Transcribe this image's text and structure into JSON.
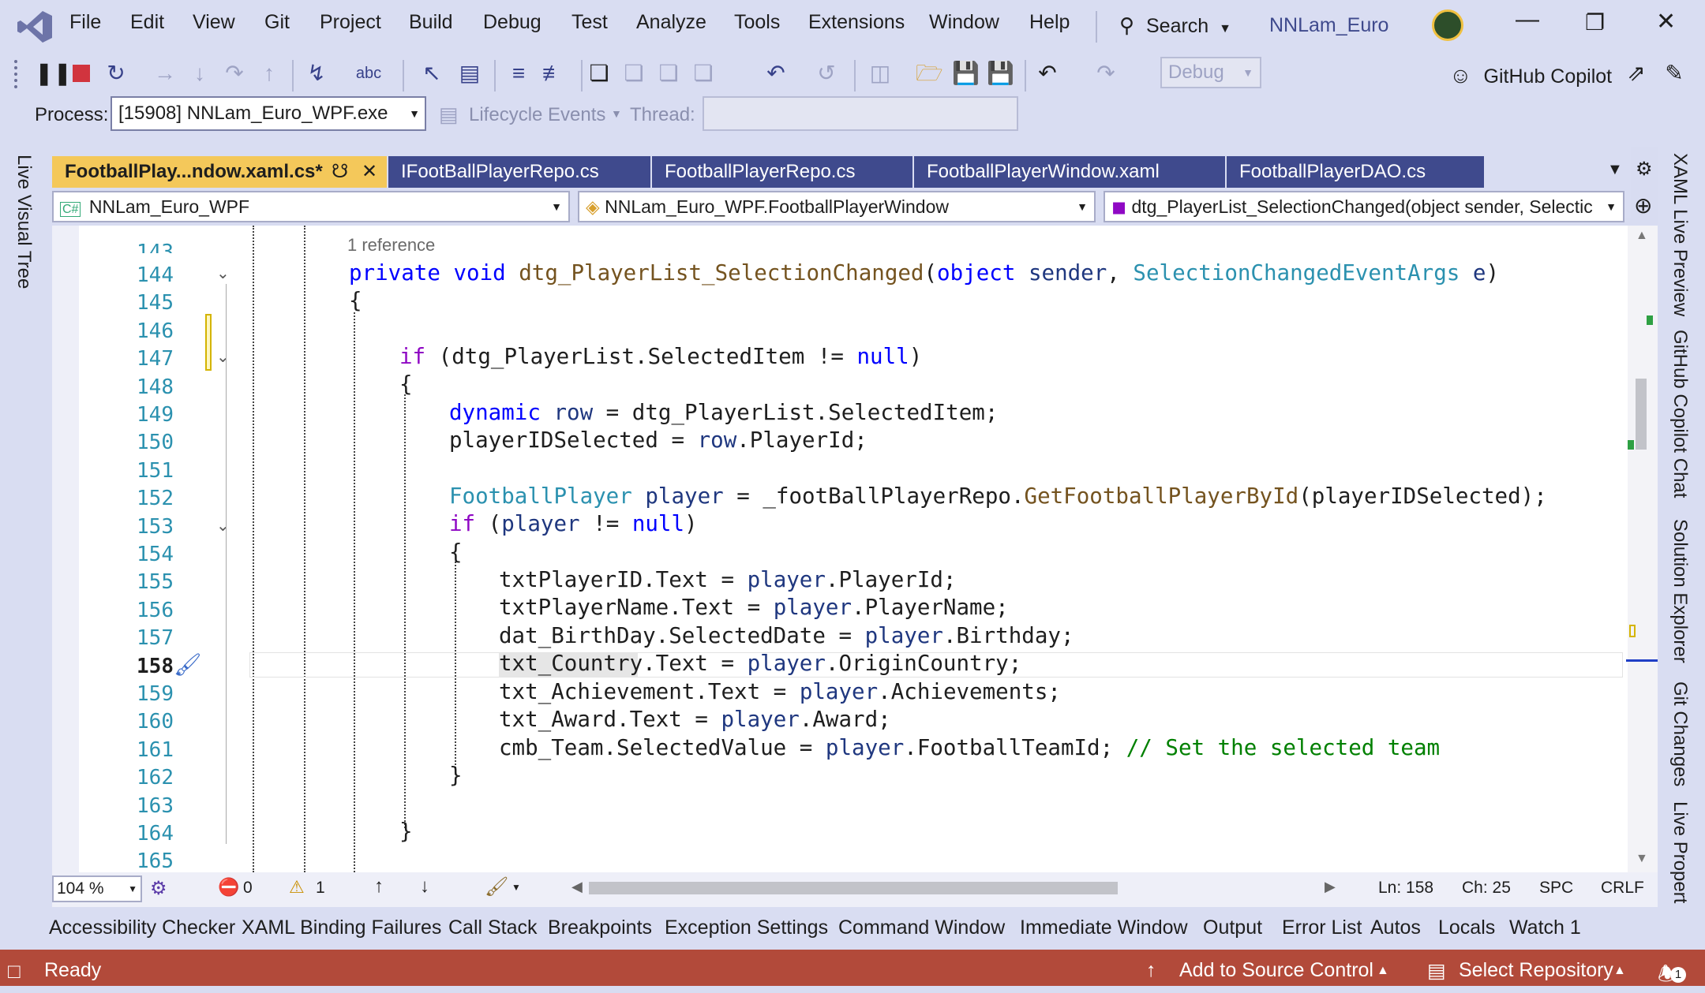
{
  "menu": {
    "items": [
      "File",
      "Edit",
      "View",
      "Git",
      "Project",
      "Build",
      "Debug",
      "Test",
      "Analyze",
      "Tools",
      "Extensions",
      "Window",
      "Help"
    ]
  },
  "search": {
    "label": "Search"
  },
  "solution_name": "NNLam_Euro",
  "copilot": {
    "label": "GitHub Copilot"
  },
  "toolbar": {
    "config_value": "Debug"
  },
  "process_bar": {
    "process_label": "Process:",
    "process_value": "[15908] NNLam_Euro_WPF.exe",
    "lifecycle_label": "Lifecycle Events",
    "thread_label": "Thread:"
  },
  "tabs": [
    {
      "label": "FootballPlay...ndow.xaml.cs*"
    },
    {
      "label": "IFootBallPlayerRepo.cs"
    },
    {
      "label": "FootballPlayerRepo.cs"
    },
    {
      "label": "FootballPlayerWindow.xaml"
    },
    {
      "label": "FootballPlayerDAO.cs"
    }
  ],
  "nav": {
    "project": "NNLam_Euro_WPF",
    "class": "NNLam_Euro_WPF.FootballPlayerWindow",
    "member": "dtg_PlayerList_SelectionChanged(object sender, Selectic"
  },
  "editor": {
    "reference_hint": "1 reference",
    "lines": [
      "144",
      "145",
      "146",
      "147",
      "148",
      "149",
      "150",
      "151",
      "152",
      "153",
      "154",
      "155",
      "156",
      "157",
      "158",
      "159",
      "160",
      "161",
      "162",
      "163",
      "164",
      "165"
    ],
    "top_partial_line": "143"
  },
  "left_panel": {
    "label": "Live Visual Tree"
  },
  "right_panel": {
    "items": [
      "XAML Live Preview",
      "GitHub Copilot Chat",
      "Solution Explorer",
      "Git Changes",
      "Live Propert"
    ]
  },
  "editor_status": {
    "zoom": "104 %",
    "errors": "0",
    "warnings": "1",
    "ln": "Ln: 158",
    "ch": "Ch: 25",
    "spc": "SPC",
    "crlf": "CRLF"
  },
  "tool_windows": [
    "Accessibility Checker",
    "XAML Binding Failures",
    "Call Stack",
    "Breakpoints",
    "Exception Settings",
    "Command Window",
    "Immediate Window",
    "Output",
    "Error List",
    "Autos",
    "Locals",
    "Watch 1"
  ],
  "status": {
    "ready": "Ready",
    "source_control": "Add to Source Control",
    "repo": "Select Repository",
    "notifications": "1"
  },
  "colors": {
    "status_bar": "#b24a3a",
    "active_tab": "#f4c85a",
    "inactive_tab": "#3f4a8d"
  }
}
